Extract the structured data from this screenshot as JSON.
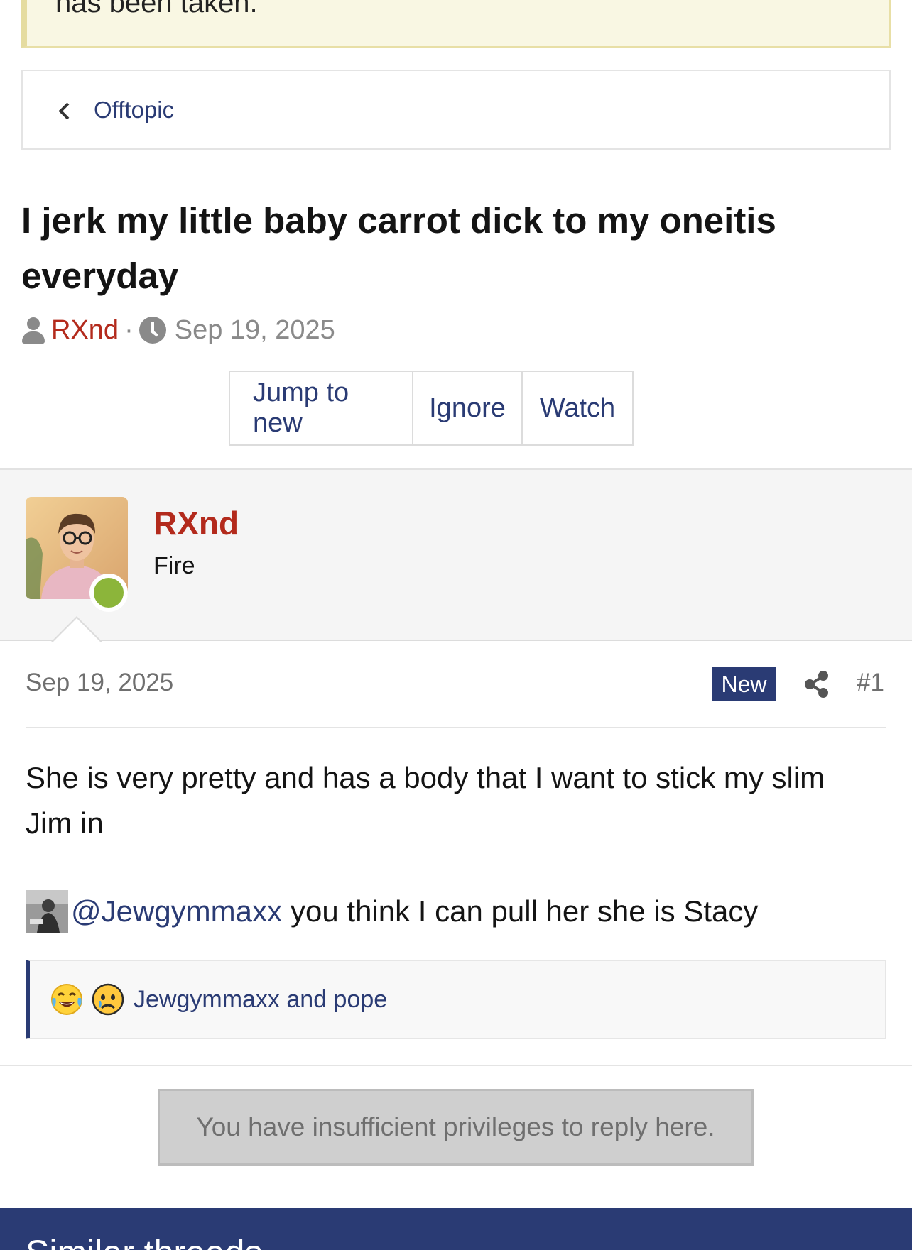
{
  "notice": {
    "text": "has been taken."
  },
  "breadcrumb": {
    "label": "Offtopic"
  },
  "thread": {
    "title": "I jerk my little baby carrot dick to my oneitis everyday",
    "author": "RXnd",
    "separator": "·",
    "date": "Sep 19, 2025"
  },
  "actions": {
    "jump": "Jump to new",
    "ignore": "Ignore",
    "watch": "Watch"
  },
  "post": {
    "username": "RXnd",
    "user_title": "Fire",
    "date": "Sep 19, 2025",
    "badge": "New",
    "number": "#1",
    "paragraph1": "She is very pretty and has a body that I want to stick my slim Jim in",
    "mention": "@Jewgymmaxx",
    "paragraph2": "you think I can pull her she is Stacy",
    "reactions": {
      "icons": [
        "tears-of-joy-emoji",
        "sad-face-emoji"
      ],
      "text": "Jewgymmaxx and pope"
    }
  },
  "reply": {
    "message": "You have insufficient privileges to reply here."
  },
  "similar": {
    "heading": "Similar threads"
  },
  "colors": {
    "accent": "#2a3b74",
    "author": "#b32a1c",
    "online": "#8cb53a",
    "notice_bg": "#f9f7e3"
  }
}
